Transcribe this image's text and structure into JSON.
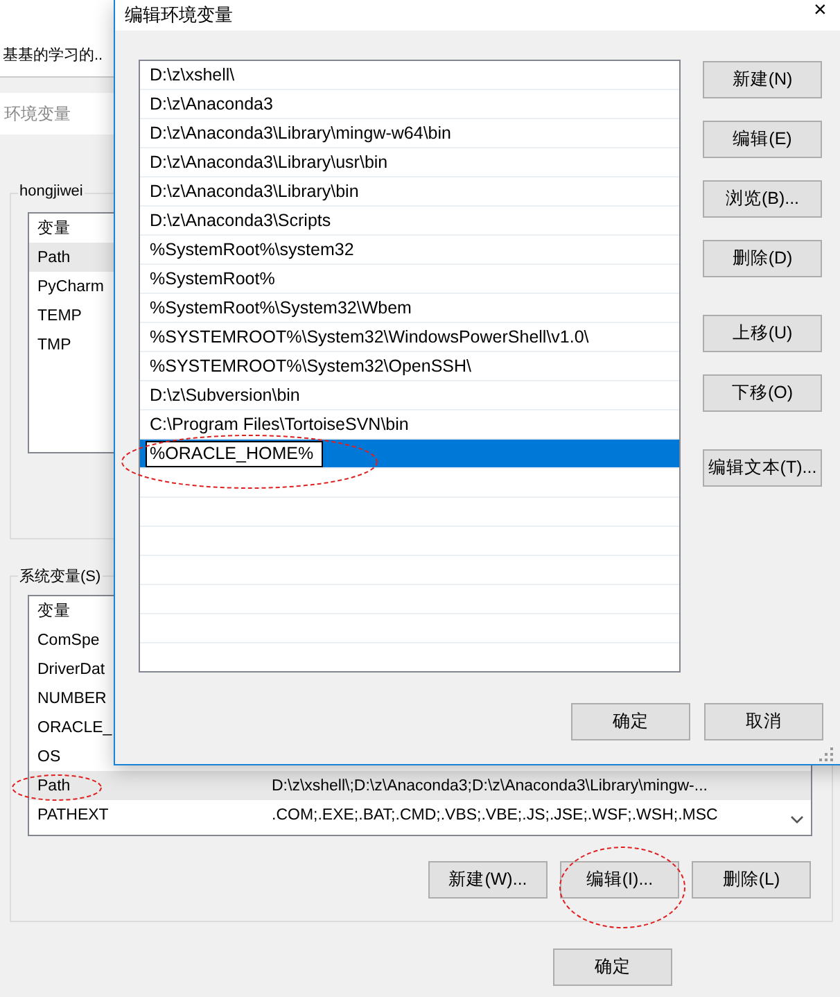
{
  "background_window": {
    "header_text": "基基的学习的..",
    "search": {
      "placeholder": "环境变量"
    },
    "user_vars": {
      "title": "hongjiwei",
      "header": "变量",
      "rows": [
        {
          "name": "Path",
          "selected": true
        },
        {
          "name": "PyCharm",
          "selected": false
        },
        {
          "name": "TEMP",
          "selected": false
        },
        {
          "name": "TMP",
          "selected": false
        }
      ]
    },
    "system_vars": {
      "title": "系统变量(S)",
      "header": "变量",
      "rows": [
        {
          "name": "ComSpe",
          "selected": false
        },
        {
          "name": "DriverDat",
          "selected": false
        },
        {
          "name": "NUMBER",
          "selected": false
        },
        {
          "name": "ORACLE_",
          "selected": false
        },
        {
          "name": "OS",
          "selected": false
        },
        {
          "name": "Path",
          "value": "D:\\z\\xshell\\;D:\\z\\Anaconda3;D:\\z\\Anaconda3\\Library\\mingw-...",
          "selected": true
        },
        {
          "name": "PATHEXT",
          "value": ".COM;.EXE;.BAT;.CMD;.VBS;.VBE;.JS;.JSE;.WSF;.WSH;.MSC",
          "selected": false
        }
      ]
    },
    "buttons": [
      "新建(W)...",
      "编辑(I)...",
      "删除(L)"
    ],
    "footer_buttons": [
      "确定"
    ]
  },
  "dialog": {
    "title": "编辑环境变量",
    "close": "×",
    "entries": [
      {
        "text": "D:\\z\\xshell\\",
        "selected": false
      },
      {
        "text": "D:\\z\\Anaconda3",
        "selected": false
      },
      {
        "text": "D:\\z\\Anaconda3\\Library\\mingw-w64\\bin",
        "selected": false
      },
      {
        "text": "D:\\z\\Anaconda3\\Library\\usr\\bin",
        "selected": false
      },
      {
        "text": "D:\\z\\Anaconda3\\Library\\bin",
        "selected": false
      },
      {
        "text": "D:\\z\\Anaconda3\\Scripts",
        "selected": false
      },
      {
        "text": "%SystemRoot%\\system32",
        "selected": false
      },
      {
        "text": "%SystemRoot%",
        "selected": false
      },
      {
        "text": "%SystemRoot%\\System32\\Wbem",
        "selected": false
      },
      {
        "text": "%SYSTEMROOT%\\System32\\WindowsPowerShell\\v1.0\\",
        "selected": false
      },
      {
        "text": "%SYSTEMROOT%\\System32\\OpenSSH\\",
        "selected": false
      },
      {
        "text": "D:\\z\\Subversion\\bin",
        "selected": false
      },
      {
        "text": "C:\\Program Files\\TortoiseSVN\\bin",
        "selected": false
      },
      {
        "text": "%ORACLE_HOME%",
        "selected": true
      }
    ],
    "side_button_groups": [
      [
        "新建(N)",
        "编辑(E)",
        "浏览(B)...",
        "删除(D)"
      ],
      [
        "上移(U)",
        "下移(O)"
      ],
      [
        "编辑文本(T)..."
      ]
    ],
    "footer_buttons": [
      "确定",
      "取消"
    ]
  }
}
